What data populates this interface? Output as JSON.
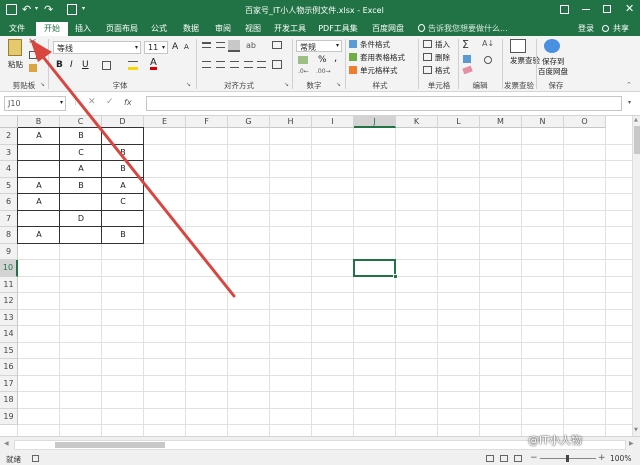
{
  "window": {
    "title": "百家号_IT小人物示例文件.xlsx - Excel",
    "quick_access": {
      "save": "save-icon",
      "undo": "undo-icon",
      "redo": "redo-icon",
      "print_preview": "print-preview-icon"
    },
    "controls": {
      "ribbon_options": "ribbon-options-icon",
      "minimize": "minimize-icon",
      "restore": "restore-icon",
      "close": "close-icon"
    }
  },
  "tabs": [
    "文件",
    "开始",
    "插入",
    "页面布局",
    "公式",
    "数据",
    "审阅",
    "视图",
    "开发工具",
    "PDF工具集",
    "百度网盘"
  ],
  "tell_me": "告诉我您想要做什么...",
  "login": "登录",
  "share": "共享",
  "ribbon": {
    "clipboard": {
      "label": "剪贴板",
      "paste": "粘贴"
    },
    "font": {
      "label": "字体",
      "name": "等线",
      "size": "11",
      "bold": "B",
      "italic": "I",
      "underline": "U",
      "grow": "A",
      "shrink": "A"
    },
    "alignment": {
      "label": "对齐方式"
    },
    "number": {
      "label": "数字",
      "format": "常规",
      "percent": "%",
      "comma": ","
    },
    "styles": {
      "label": "样式",
      "conditional": "条件格式",
      "table": "套用表格格式",
      "cell": "单元格样式"
    },
    "cells": {
      "label": "单元格",
      "insert": "插入",
      "delete": "删除",
      "format": "格式"
    },
    "editing": {
      "label": "编辑"
    },
    "invoice": {
      "label": "发票查验",
      "btn": "发票查验"
    },
    "save": {
      "label": "保存",
      "btn1": "保存到",
      "btn2": "百度网盘"
    }
  },
  "formula_bar": {
    "name_box": "J10",
    "fx": "fx",
    "value": ""
  },
  "columns": [
    "B",
    "C",
    "D",
    "E",
    "F",
    "G",
    "H",
    "I",
    "J",
    "K",
    "L",
    "M",
    "N",
    "O"
  ],
  "rows": [
    "2",
    "3",
    "4",
    "5",
    "6",
    "7",
    "8",
    "9",
    "10",
    "11",
    "12",
    "13",
    "14",
    "15",
    "16",
    "17",
    "18",
    "19"
  ],
  "cells": {
    "r2": [
      "A",
      "B",
      ""
    ],
    "r3": [
      "",
      "C",
      "B"
    ],
    "r4": [
      "",
      "A",
      "B"
    ],
    "r5": [
      "A",
      "B",
      "A"
    ],
    "r6": [
      "A",
      "",
      "C"
    ],
    "r7": [
      "",
      "D",
      ""
    ],
    "r8": [
      "A",
      "",
      "B"
    ]
  },
  "selected_cell": "J10",
  "status": {
    "ready": "就绪",
    "zoom": "100%"
  },
  "watermark": "@IT小人物",
  "colors": {
    "accent": "#217346",
    "arrow": "#d9453f"
  }
}
